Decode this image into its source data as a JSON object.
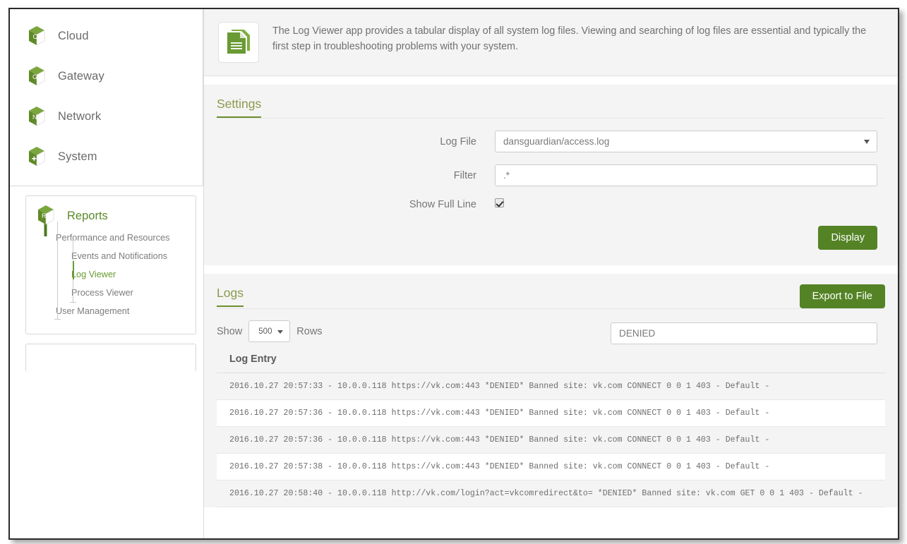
{
  "sidebar": {
    "items": [
      {
        "label": "Cloud",
        "icon": "cube-cloud-icon",
        "glyph": "C"
      },
      {
        "label": "Gateway",
        "icon": "cube-gateway-icon",
        "glyph": "G"
      },
      {
        "label": "Network",
        "icon": "cube-network-icon",
        "glyph": "N"
      },
      {
        "label": "System",
        "icon": "cube-system-icon",
        "glyph": "+"
      }
    ],
    "reports": {
      "label": "Reports",
      "icon": "cube-reports-icon",
      "glyph": "R",
      "sub_items": [
        {
          "label": "Performance and Resources",
          "level": 1,
          "active": false
        },
        {
          "label": "Events and Notifications",
          "level": 2,
          "active": false
        },
        {
          "label": "Log Viewer",
          "level": 2,
          "active": true
        },
        {
          "label": "Process Viewer",
          "level": 2,
          "active": false
        },
        {
          "label": "User Management",
          "level": 1,
          "active": false
        }
      ]
    }
  },
  "header": {
    "icon": "log-document-icon",
    "description": "The Log Viewer app provides a tabular display of all system log files. Viewing and searching of log files are essential and typically the first step in troubleshooting problems with your system."
  },
  "settings": {
    "title": "Settings",
    "log_file": {
      "label": "Log File",
      "value": "dansguardian/access.log"
    },
    "filter": {
      "label": "Filter",
      "value": ".*",
      "placeholder": ".*"
    },
    "show_full_line": {
      "label": "Show Full Line",
      "checked": true
    },
    "display_button": "Display"
  },
  "logs": {
    "title": "Logs",
    "export_button": "Export to File",
    "show_label": "Show",
    "rows_label": "Rows",
    "rows_value": "500",
    "search_value": "DENIED",
    "column_header": "Log Entry",
    "entries": [
      "2016.10.27 20:57:33 - 10.0.0.118 https://vk.com:443 *DENIED* Banned site: vk.com CONNECT 0 0 1 403 - Default -",
      "2016.10.27 20:57:36 - 10.0.0.118 https://vk.com:443 *DENIED* Banned site: vk.com CONNECT 0 0 1 403 - Default -",
      "2016.10.27 20:57:36 - 10.0.0.118 https://vk.com:443 *DENIED* Banned site: vk.com CONNECT 0 0 1 403 - Default -",
      "2016.10.27 20:57:38 - 10.0.0.118 https://vk.com:443 *DENIED* Banned site: vk.com CONNECT 0 0 1 403 - Default -",
      "2016.10.27 20:58:40 - 10.0.0.118 http://vk.com/login?act=vkcomredirect&to= *DENIED* Banned site: vk.com GET 0 0 1 403 - Default -"
    ]
  },
  "colors": {
    "accent_green": "#548325",
    "link_green": "#6a9a33",
    "heading_olive": "#8a9a4e",
    "panel_bg": "#f4f4f4"
  }
}
